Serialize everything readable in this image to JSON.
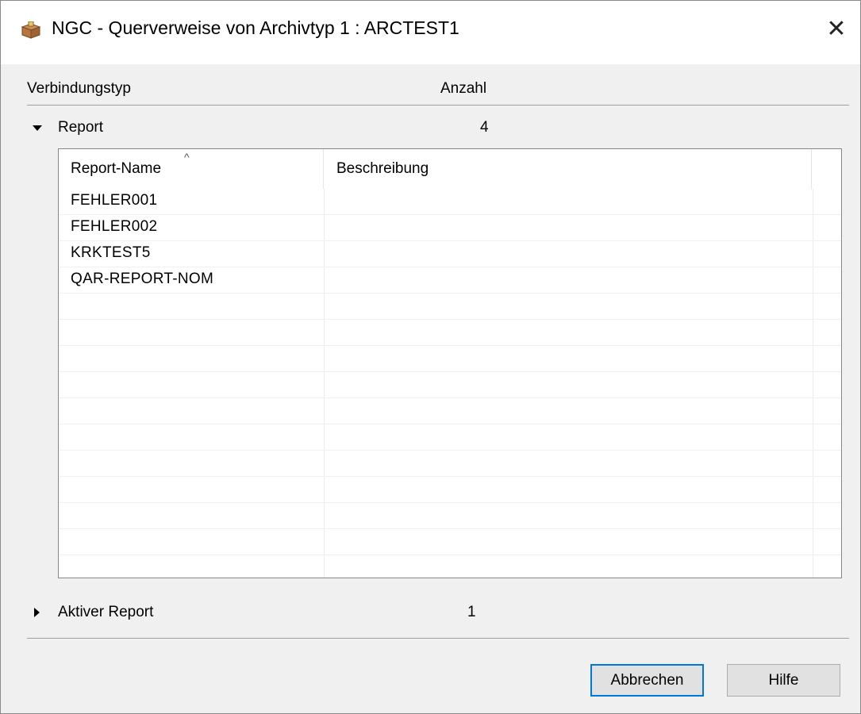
{
  "window": {
    "title": "NGC - Querverweise von Archivtyp 1 : ARCTEST1",
    "close_glyph": "✕",
    "icon": "package-icon"
  },
  "header": {
    "col_type": "Verbindungstyp",
    "col_count": "Anzahl"
  },
  "groups": [
    {
      "label": "Report",
      "count": "4",
      "expanded": true,
      "table": {
        "columns": [
          "Report-Name",
          "Beschreibung"
        ],
        "sort_indicator": "^",
        "rows": [
          {
            "name": "FEHLER001",
            "desc": ""
          },
          {
            "name": "FEHLER002",
            "desc": ""
          },
          {
            "name": "KRKTEST5",
            "desc": ""
          },
          {
            "name": "QAR-REPORT-NOM",
            "desc": ""
          }
        ]
      }
    },
    {
      "label": "Aktiver Report",
      "count": "1",
      "expanded": false
    }
  ],
  "buttons": {
    "cancel": "Abbrechen",
    "help": "Hilfe"
  },
  "colors": {
    "accent": "#0078d7",
    "dialog_bg": "#f0f0f0",
    "grid_border": "#828790"
  }
}
